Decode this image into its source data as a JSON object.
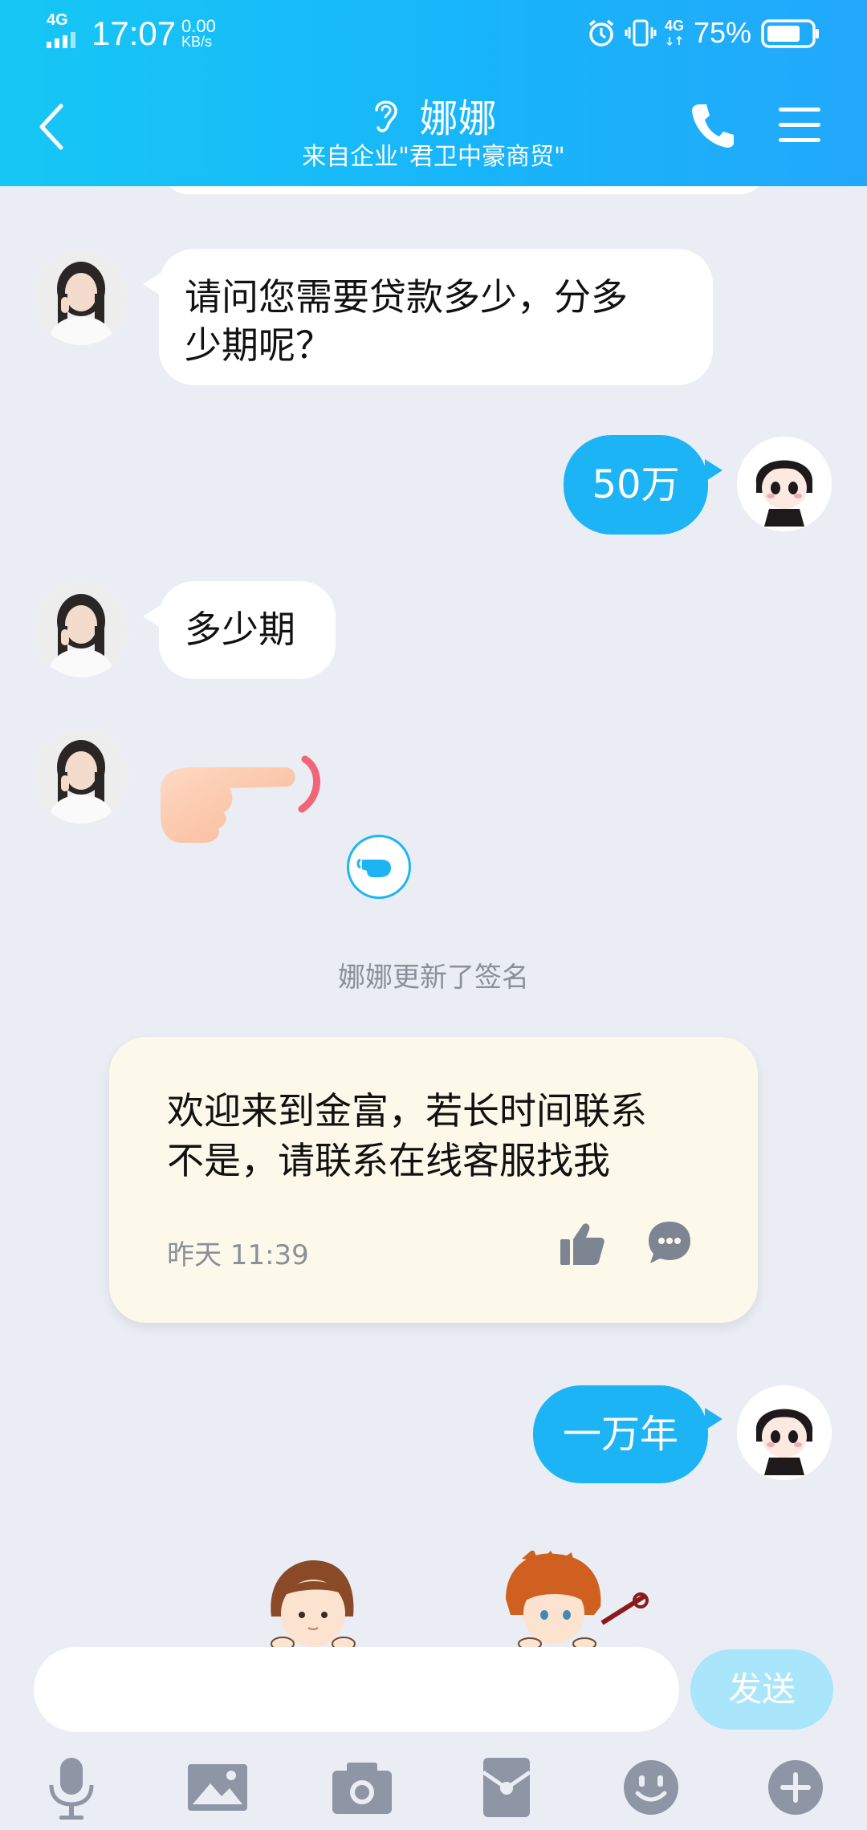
{
  "status_bar": {
    "network": "4G",
    "time": "17:07",
    "speed_value": "0.00",
    "speed_unit": "KB/s",
    "network2": "4G",
    "battery": "75%"
  },
  "header": {
    "title": "娜娜",
    "subtitle": "来自企业\"君卫中豪商贸\""
  },
  "messages": [
    {
      "side": "in",
      "text_lines": [
        "请问您需要贷款多少，分多",
        "少期呢？"
      ]
    },
    {
      "side": "out",
      "text": "50万"
    },
    {
      "side": "in",
      "text": "多少期"
    },
    {
      "side": "in",
      "type": "sticker",
      "sticker": "pointing-hand"
    },
    {
      "type": "system",
      "text": "娜娜更新了签名"
    },
    {
      "type": "signature",
      "text_lines": [
        "欢迎来到金富，若长时间联系",
        "不是，请联系在线客服找我"
      ],
      "time": "昨天 11:39"
    },
    {
      "side": "out",
      "text": "一万年"
    }
  ],
  "input": {
    "placeholder": "",
    "send_label": "发送"
  },
  "toolbar": [
    "microphone-icon",
    "image-icon",
    "camera-icon",
    "red-packet-icon",
    "emoji-icon",
    "plus-icon"
  ],
  "colors": {
    "header_start": "#16C7F5",
    "header_end": "#22A8FB",
    "outgoing_bubble": "#1DB4F5",
    "background": "#EAEDF4",
    "signature_card": "#FDF9EA",
    "send_button": "#A9E5FB"
  }
}
